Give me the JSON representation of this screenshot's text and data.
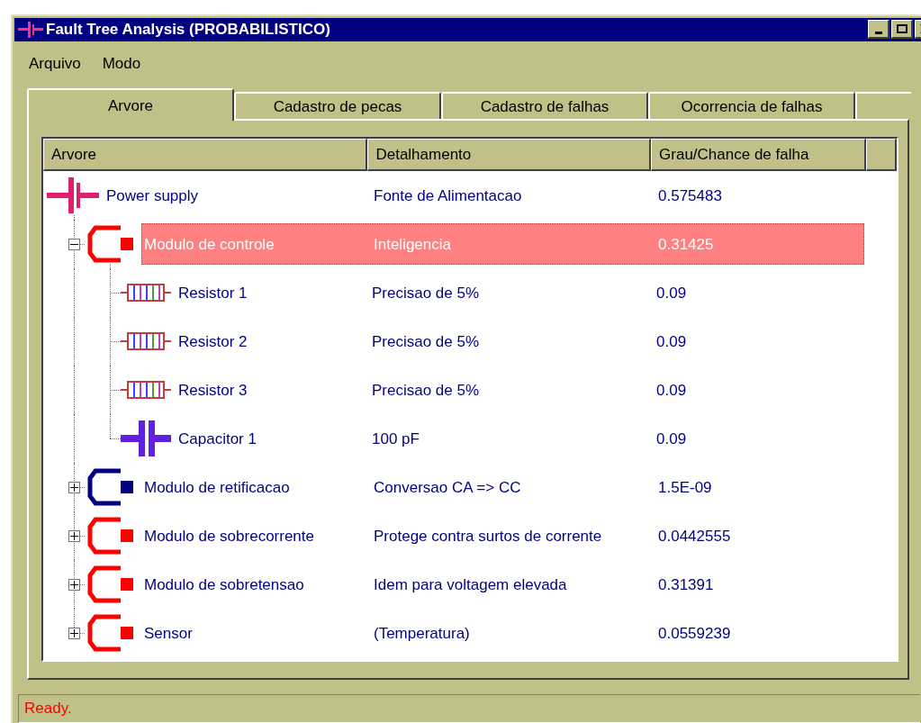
{
  "window": {
    "title": "Fault Tree Analysis (PROBABILISTICO)"
  },
  "menu": [
    "Arquivo",
    "Modo"
  ],
  "tabs": [
    {
      "label": "Arvore",
      "selected": true
    },
    {
      "label": "Cadastro de pecas",
      "selected": false
    },
    {
      "label": "Cadastro de falhas",
      "selected": false
    },
    {
      "label": "Ocorrencia de falhas",
      "selected": false
    }
  ],
  "tree": {
    "columns": [
      "Arvore",
      "Detalhamento",
      "Grau/Chance de falha"
    ],
    "nodes": [
      {
        "kind": "battery",
        "color": "#e0206f",
        "name": "Power supply",
        "detail": "Fonte de Alimentacao",
        "chance": "0.575483",
        "selected": false,
        "children": [
          {
            "kind": "gate",
            "color": "#ff0000",
            "name": "Modulo de controle",
            "detail": "Inteligencia",
            "chance": "0.31425",
            "selected": true,
            "expanded": true,
            "children": [
              {
                "kind": "resistor",
                "color": "#c04040",
                "name": "Resistor 1",
                "detail": "Precisao de 5%",
                "chance": "0.09",
                "selected": false
              },
              {
                "kind": "resistor",
                "color": "#c04040",
                "name": "Resistor 2",
                "detail": "Precisao de 5%",
                "chance": "0.09",
                "selected": false
              },
              {
                "kind": "resistor",
                "color": "#c04040",
                "name": "Resistor 3",
                "detail": "Precisao de 5%",
                "chance": "0.09",
                "selected": false
              },
              {
                "kind": "capacitor",
                "color": "#6020e0",
                "name": "Capacitor 1",
                "detail": "100 pF",
                "chance": "0.09",
                "selected": false
              }
            ]
          },
          {
            "kind": "gate",
            "color": "#000080",
            "name": "Modulo de retificacao",
            "detail": "Conversao CA => CC",
            "chance": "1.5E-09",
            "selected": false,
            "expanded": false
          },
          {
            "kind": "gate",
            "color": "#ff0000",
            "name": "Modulo de sobrecorrente",
            "detail": "Protege contra surtos de corrente",
            "chance": "0.0442555",
            "selected": false,
            "expanded": false
          },
          {
            "kind": "gate",
            "color": "#ff0000",
            "name": "Modulo de sobretensao",
            "detail": "Idem para voltagem elevada",
            "chance": "0.31391",
            "selected": false,
            "expanded": false
          },
          {
            "kind": "gate",
            "color": "#ff0000",
            "name": "Sensor",
            "detail": "(Temperatura)",
            "chance": "0.0559239",
            "selected": false,
            "expanded": false
          }
        ]
      }
    ]
  },
  "status_bar": {
    "text": "Ready."
  }
}
